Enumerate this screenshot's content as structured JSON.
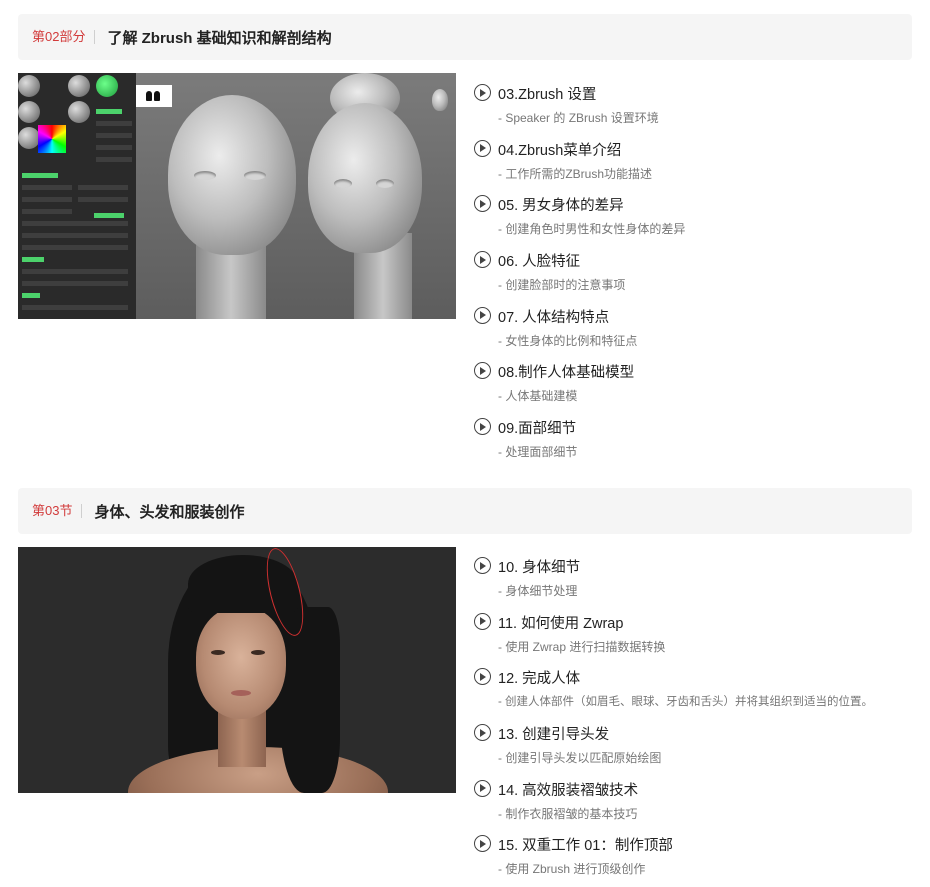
{
  "sections": [
    {
      "tag": "第02部分",
      "title": "了解 Zbrush 基础知识和解剖结构",
      "lessons": [
        {
          "title": "03.Zbrush 设置",
          "subtitle": "- Speaker 的 ZBrush 设置环境"
        },
        {
          "title": "04.Zbrush菜单介绍",
          "subtitle": "- 工作所需的ZBrush功能描述"
        },
        {
          "title": "05. 男女身体的差异",
          "subtitle": "- 创建角色时男性和女性身体的差异"
        },
        {
          "title": "06. 人脸特征",
          "subtitle": "- 创建脸部时的注意事项"
        },
        {
          "title": "07. 人体结构特点",
          "subtitle": "- 女性身体的比例和特征点"
        },
        {
          "title": "08.制作人体基础模型",
          "subtitle": "- 人体基础建模"
        },
        {
          "title": "09.面部细节",
          "subtitle": "- 处理面部细节"
        }
      ]
    },
    {
      "tag": "第03节",
      "title": "身体、头发和服装创作",
      "lessons": [
        {
          "title": "10. 身体细节",
          "subtitle": "- 身体细节处理"
        },
        {
          "title": "11. 如何使用 Zwrap",
          "subtitle": "- 使用 Zwrap 进行扫描数据转换"
        },
        {
          "title": "12. 完成人体",
          "subtitle": "- 创建人体部件（如眉毛、眼球、牙齿和舌头）并将其组织到适当的位置。"
        },
        {
          "title": "13. 创建引导头发",
          "subtitle": "- 创建引导头发以匹配原始绘图"
        },
        {
          "title": "14. 高效服装褶皱技术",
          "subtitle": "- 制作衣服褶皱的基本技巧"
        },
        {
          "title": "15. 双重工作 01：制作顶部",
          "subtitle": "- 使用 Zbrush 进行顶级创作"
        }
      ]
    }
  ]
}
